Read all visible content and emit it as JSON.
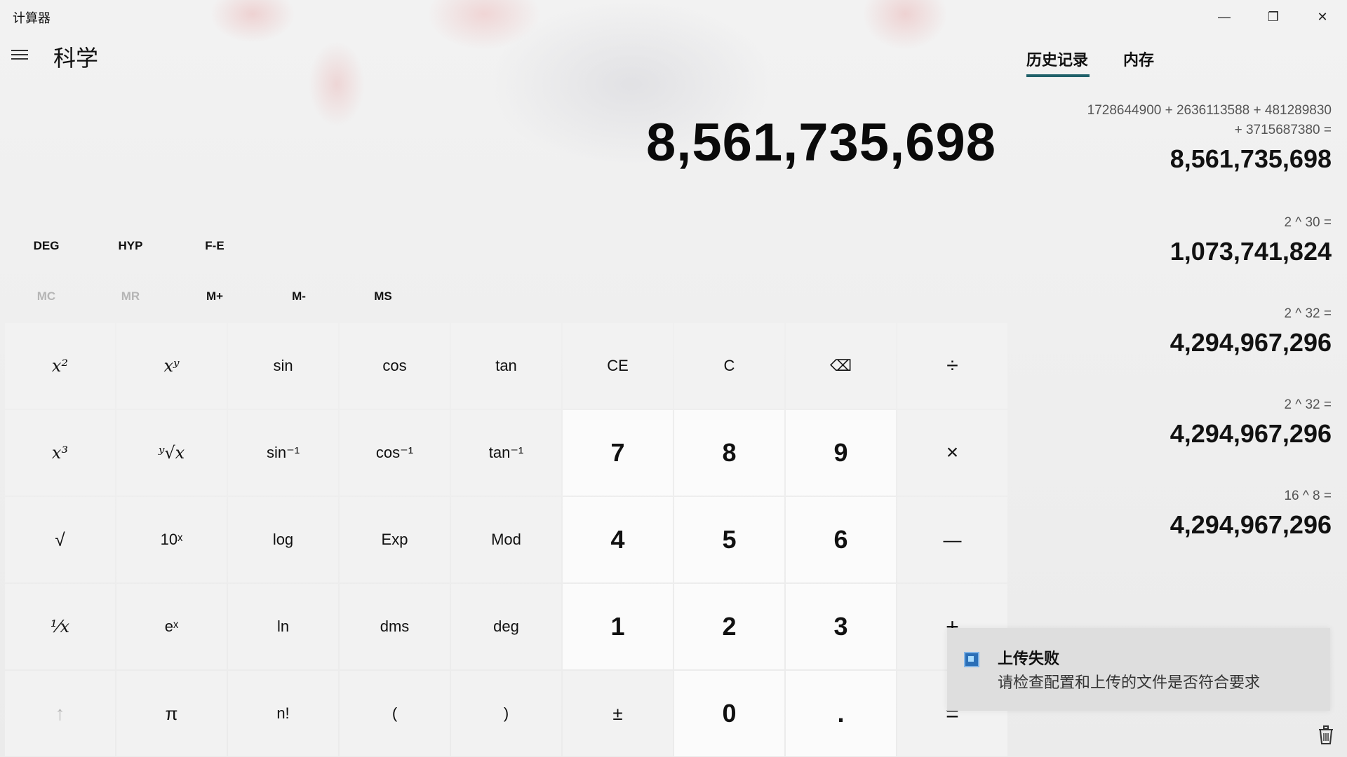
{
  "window": {
    "title": "计算器",
    "minimize_glyph": "—",
    "maximize_glyph": "❐",
    "close_glyph": "✕"
  },
  "header": {
    "mode": "科学",
    "menu_icon": "hamburger-icon"
  },
  "display": {
    "value": "8,561,735,698"
  },
  "modes": [
    "DEG",
    "HYP",
    "F-E"
  ],
  "memory": [
    {
      "label": "MC",
      "enabled": false
    },
    {
      "label": "MR",
      "enabled": false
    },
    {
      "label": "M+",
      "enabled": true
    },
    {
      "label": "M-",
      "enabled": true
    },
    {
      "label": "MS",
      "enabled": true
    }
  ],
  "keys": {
    "x_squared": "x²",
    "x_power_y": "xʸ",
    "sin": "sin",
    "cos": "cos",
    "tan": "tan",
    "ce": "CE",
    "c": "C",
    "backspace": "⌫",
    "divide": "÷",
    "x_cubed": "x³",
    "y_root_x": "ʸ√x",
    "asin": "sin⁻¹",
    "acos": "cos⁻¹",
    "atan": "tan⁻¹",
    "seven": "7",
    "eight": "8",
    "nine": "9",
    "multiply": "×",
    "sqrt": "√",
    "ten_power_x": "10ˣ",
    "log": "log",
    "exp": "Exp",
    "mod": "Mod",
    "four": "4",
    "five": "5",
    "six": "6",
    "minus": "—",
    "reciprocal": "⅟x",
    "e_power_x": "eˣ",
    "ln": "ln",
    "dms": "dms",
    "deg": "deg",
    "one": "1",
    "two": "2",
    "three": "3",
    "plus": "+",
    "shift": "↑",
    "pi": "π",
    "factorial": "n!",
    "lparen": "(",
    "rparen": ")",
    "negate": "±",
    "zero": "0",
    "decimal": ".",
    "equals": "="
  },
  "panel": {
    "tab_history": "历史记录",
    "tab_memory": "内存",
    "history": [
      {
        "expr_line1": "1728644900 + 2636113588 + 481289830",
        "expr_line2": "+ 3715687380 =",
        "result": "8,561,735,698"
      },
      {
        "expr_line1": "2 ^ 30 =",
        "expr_line2": "",
        "result": "1,073,741,824"
      },
      {
        "expr_line1": "2 ^ 32 =",
        "expr_line2": "",
        "result": "4,294,967,296"
      },
      {
        "expr_line1": "2 ^ 32 =",
        "expr_line2": "",
        "result": "4,294,967,296"
      },
      {
        "expr_line1": "16 ^ 8 =",
        "expr_line2": "",
        "result": "4,294,967,296"
      }
    ],
    "trash_icon": "trash-icon"
  },
  "toast": {
    "title": "上传失败",
    "body": "请检查配置和上传的文件是否符合要求"
  },
  "colors": {
    "accent": "#1f6069",
    "background": "#ececec",
    "key": "#f2f2f2",
    "number_key": "#fbfbfb"
  }
}
